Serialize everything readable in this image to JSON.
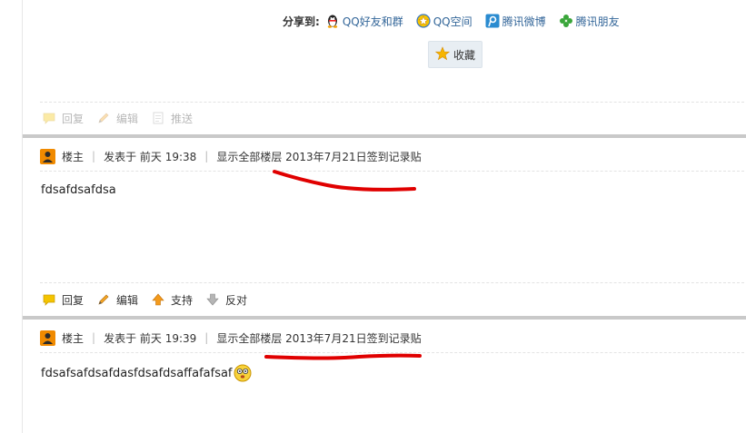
{
  "share": {
    "label": "分享到:",
    "items": [
      {
        "label": "QQ好友和群",
        "icon": "qq-penguin-icon"
      },
      {
        "label": "QQ空间",
        "icon": "qzone-star-icon"
      },
      {
        "label": "腾讯微博",
        "icon": "tencent-weibo-icon"
      },
      {
        "label": "腾讯朋友",
        "icon": "clover-icon"
      }
    ],
    "favorite_label": "收藏"
  },
  "first_actions": {
    "reply": "回复",
    "edit": "编辑",
    "push": "推送"
  },
  "posts": [
    {
      "role": "楼主",
      "posted": "发表于 前天 19:38",
      "thread": "显示全部楼层 2013年7月21日签到记录贴",
      "body": "fdsafdsafdsa",
      "actions": {
        "reply": "回复",
        "edit": "编辑",
        "support": "支持",
        "oppose": "反对"
      }
    },
    {
      "role": "楼主",
      "posted": "发表于 前天 19:39",
      "thread": "显示全部楼层 2013年7月21日签到记录贴",
      "body": "fdsafsafdsafdasfdsafdsaffafafsaf"
    }
  ],
  "colors": {
    "link": "#336699",
    "separator": "#c9c9c9",
    "annotation": "#e00000"
  }
}
